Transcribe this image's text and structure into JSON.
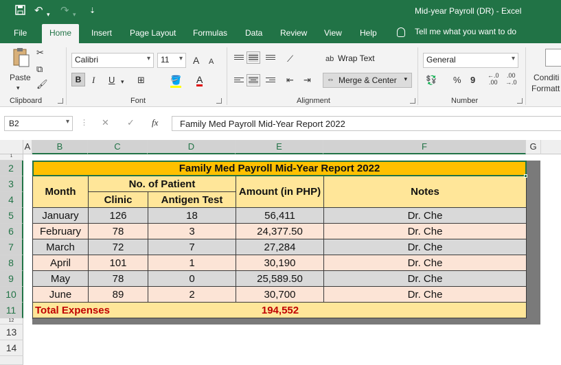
{
  "window": {
    "title": "Mid-year Payroll (DR)  -  Excel"
  },
  "quick_access": {
    "save_icon": "save-icon",
    "undo": "↶",
    "redo": "↷",
    "customize": "⇣"
  },
  "tabs": [
    "File",
    "Home",
    "Insert",
    "Page Layout",
    "Formulas",
    "Data",
    "Review",
    "View",
    "Help"
  ],
  "active_tab": "Home",
  "tell_me": "Tell me what you want to do",
  "ribbon": {
    "clipboard": {
      "paste": "Paste",
      "label": "Clipboard"
    },
    "font": {
      "name": "Calibri",
      "size": "11",
      "bold": "B",
      "italic": "I",
      "underline": "U",
      "label": "Font",
      "grow": "A",
      "shrink": "A"
    },
    "alignment": {
      "wrap_text": "Wrap Text",
      "merge_center": "Merge & Center",
      "label": "Alignment"
    },
    "number": {
      "format": "General",
      "percent": "%",
      "comma": "9",
      "inc_decimal": "⁺.0\n.00",
      "label": "Number"
    },
    "styles": {
      "conditional": "Conditi",
      "formatting": "Formatt"
    }
  },
  "formula_bar": {
    "name_box": "B2",
    "fx": "fx",
    "content": "Family Med Payroll Mid-Year Report 2022"
  },
  "columns": [
    "A",
    "B",
    "C",
    "D",
    "E",
    "F",
    "G"
  ],
  "rows": [
    "2",
    "3",
    "4",
    "5",
    "6",
    "7",
    "8",
    "9",
    "10",
    "11",
    "12",
    "13",
    "14"
  ],
  "sheet": {
    "title": "Family Med Payroll Mid-Year Report 2022",
    "headers": {
      "month": "Month",
      "patients": "No. of Patient",
      "clinic": "Clinic",
      "antigen": "Antigen Test",
      "amount": "Amount (in PHP)",
      "notes": "Notes"
    },
    "data": [
      {
        "month": "January",
        "clinic": "126",
        "antigen": "18",
        "amount": "56,411",
        "notes": "Dr. Che"
      },
      {
        "month": "February",
        "clinic": "78",
        "antigen": "3",
        "amount": "24,377.50",
        "notes": "Dr. Che"
      },
      {
        "month": "March",
        "clinic": "72",
        "antigen": "7",
        "amount": "27,284",
        "notes": "Dr. Che"
      },
      {
        "month": "April",
        "clinic": "101",
        "antigen": "1",
        "amount": "30,190",
        "notes": "Dr. Che"
      },
      {
        "month": "May",
        "clinic": "78",
        "antigen": "0",
        "amount": "25,589.50",
        "notes": "Dr. Che"
      },
      {
        "month": "June",
        "clinic": "89",
        "antigen": "2",
        "amount": "30,700",
        "notes": "Dr. Che"
      }
    ],
    "total_label": "Total Expenses",
    "total_value": "194,552"
  },
  "colors": {
    "excel_green": "#217346",
    "title_fill": "#ffc000",
    "header_fill": "#ffe699",
    "gray_row": "#d9d9d9",
    "peach_row": "#fce4d6",
    "total_text": "#c00000"
  }
}
